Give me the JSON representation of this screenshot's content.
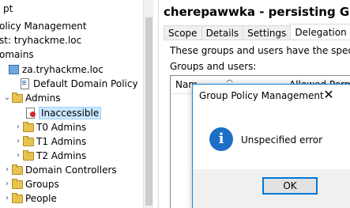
{
  "tree": {
    "items": [
      {
        "label": "pt",
        "icon": "none",
        "indent": 0,
        "chevron": ""
      },
      {
        "label": "olicy Management",
        "icon": "none",
        "indent": 0,
        "chevron": ""
      },
      {
        "label": "st: tryhackme.loc",
        "icon": "none",
        "indent": 0,
        "chevron": ""
      },
      {
        "label": "omains",
        "icon": "none",
        "indent": 0,
        "chevron": ""
      },
      {
        "label": "za.tryhackme.loc",
        "icon": "domain-icon",
        "indent": 1,
        "chevron": ""
      },
      {
        "label": "Default Domain Policy",
        "icon": "gpo-link-icon",
        "indent": 2,
        "chevron": ""
      },
      {
        "label": "Admins",
        "icon": "folder-icon",
        "indent": 1,
        "chevron": "⌄"
      },
      {
        "label": "Inaccessible",
        "icon": "access-denied-icon",
        "indent": 2,
        "chevron": "",
        "selected": true
      },
      {
        "label": "T0 Admins",
        "icon": "folder-icon",
        "indent": 2,
        "chevron": "›"
      },
      {
        "label": "T1 Admins",
        "icon": "folder-icon",
        "indent": 2,
        "chevron": "›"
      },
      {
        "label": "T2 Admins",
        "icon": "folder-icon",
        "indent": 2,
        "chevron": "›"
      },
      {
        "label": "Domain Controllers",
        "icon": "folder-icon",
        "indent": 1,
        "chevron": "›"
      },
      {
        "label": "Groups",
        "icon": "folder-icon",
        "indent": 1,
        "chevron": "›"
      },
      {
        "label": "People",
        "icon": "folder-icon",
        "indent": 1,
        "chevron": "›"
      }
    ]
  },
  "gpo_panel": {
    "title": "cherepawwka - persisting GPO",
    "tabs": [
      "Scope",
      "Details",
      "Settings",
      "Delegation"
    ],
    "active_tab": "Delegation",
    "description": "These groups and users have the specified perm",
    "groups_label": "Groups and users:",
    "columns": [
      "Nam",
      "Allowed Permi"
    ]
  },
  "dialog": {
    "title": "Group Policy Management",
    "message": "Unspecified error",
    "ok_label": "OK",
    "icon": "info-icon",
    "close_icon": "close-icon"
  }
}
